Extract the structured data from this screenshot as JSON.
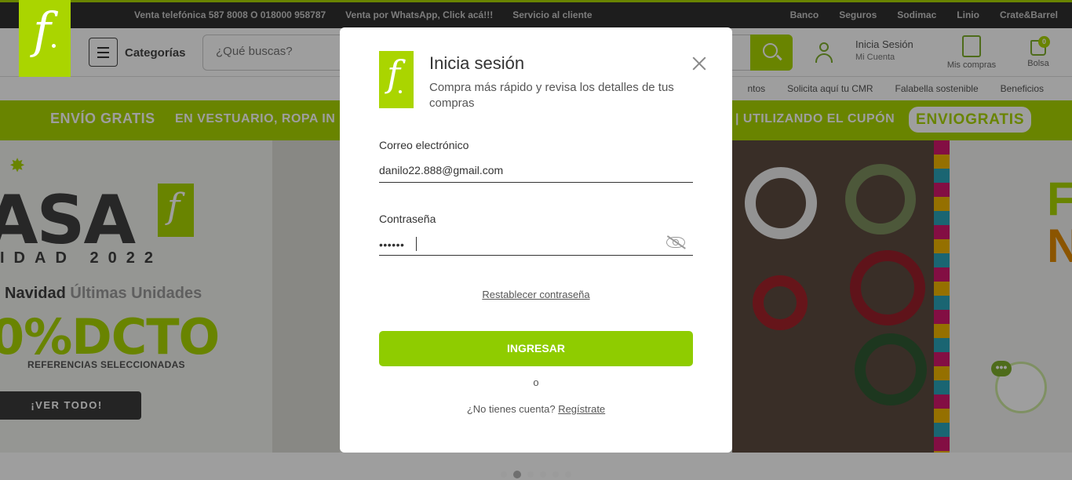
{
  "topbar": {
    "links_left": [
      "Venta telefónica 587 8008 O 018000 958787",
      "Venta por WhatsApp, Click acá!!!",
      "Servicio al cliente"
    ],
    "links_right": [
      "Banco",
      "Seguros",
      "Sodimac",
      "Linio",
      "Crate&Barrel"
    ]
  },
  "header": {
    "categories_label": "Categorías",
    "search_placeholder": "¿Qué buscas?",
    "login_line1": "Inicia Sesión",
    "login_line2": "Mi Cuenta",
    "my_orders_label": "Mis compras",
    "bag_label": "Bolsa",
    "bag_count": "0"
  },
  "subnav": {
    "partial_item": "ntos",
    "items": [
      "Solicita aquí tu CMR",
      "Falabella sostenible",
      "Beneficios"
    ]
  },
  "promo": {
    "text_left_bold": "ENVÍO GRATIS",
    "text_left_rest": "EN VESTUARIO, ROPA IN",
    "text_right": "| UTILIZANDO EL CUPÓN",
    "coupon": "ENVIOGRATIS"
  },
  "banner": {
    "casa_text": "ASA",
    "year_text": "IDAD 2022",
    "navidad_a": "Navidad",
    "navidad_b": "Últimas Unidades",
    "dcto_text": "0%DCTO",
    "refs_text": "REFERENCIAS SELECCIONADAS",
    "cta": "¡VER TODO!"
  },
  "modal": {
    "title": "Inicia sesión",
    "subtitle": "Compra más rápido y revisa los detalles de tus compras",
    "email_label": "Correo electrónico",
    "email_value": "danilo22.888@gmail.com",
    "password_label": "Contraseña",
    "password_mask": "••••••",
    "reset_link": "Restablecer contraseña",
    "submit_label": "INGRESAR",
    "or_text": "o",
    "no_account_text": "¿No tienes cuenta?",
    "register_link": "Regístrate"
  },
  "carousel": {
    "dot_count": 6,
    "active_index": 1
  },
  "colors": {
    "brand_green": "#aad500",
    "button_green": "#8fcc00",
    "overlay": "rgba(0,0,0,0.38)"
  }
}
